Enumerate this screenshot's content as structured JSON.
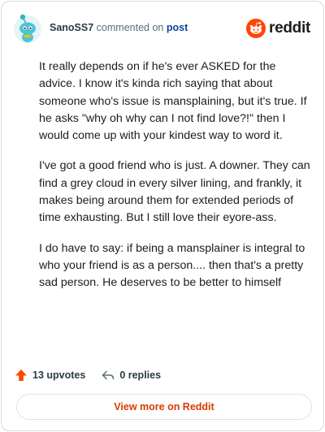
{
  "header": {
    "author": "SanoSS7",
    "commented_on": "commented on",
    "post_link": "post",
    "brand": "reddit"
  },
  "comment": {
    "paragraphs": [
      "It really depends on if he's ever ASKED for the advice. I know it's kinda rich saying that about someone who's issue is mansplaining, but it's true. If he asks \"why oh why can I not find love?!\" then I would come up with your kindest way to word it.",
      "I've got a good friend who is just. A downer. They can find a grey cloud in every silver lining, and frankly, it makes being around them for extended periods of time exhausting. But I still love their eyore-ass.",
      "I do have to say: if being a mansplainer is integral to who your friend is as a person.... then that's a pretty sad person. He deserves to be better to himself"
    ]
  },
  "actions": {
    "upvotes": "13 upvotes",
    "replies": "0 replies"
  },
  "footer": {
    "view_more": "View more on Reddit"
  },
  "colors": {
    "accent": "#d93a00",
    "upvote": "#ff4500",
    "link": "#0a449b"
  }
}
